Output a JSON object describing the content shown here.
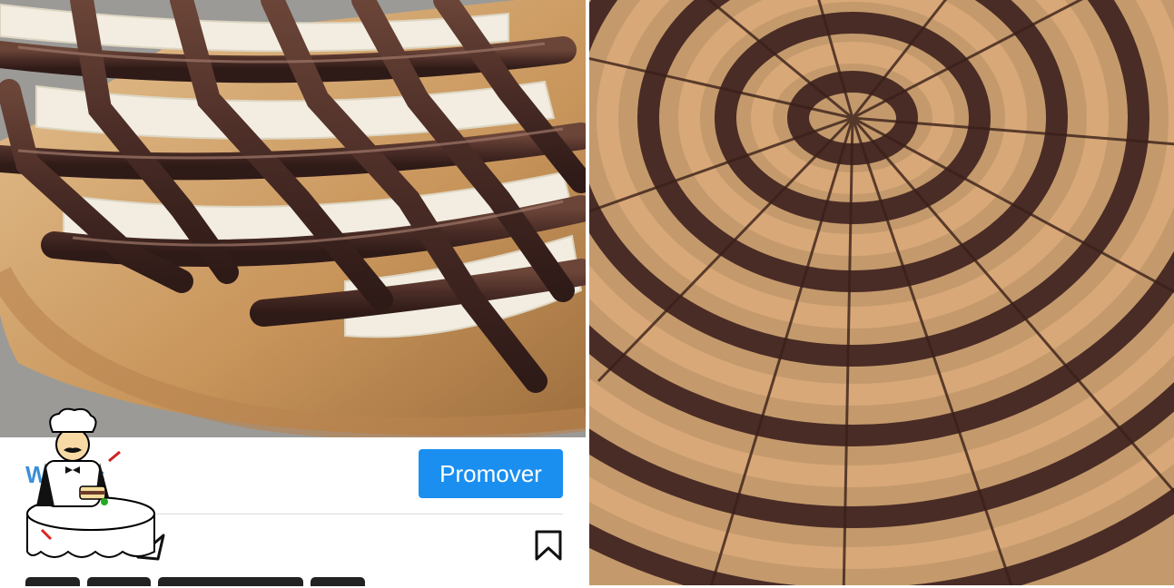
{
  "profile": {
    "name": "Wights"
  },
  "actions": {
    "promote_label": "Promover"
  },
  "icons": {
    "send": "send-icon",
    "bookmark": "bookmark-icon",
    "chef": "chef-restaurant-icon"
  },
  "colors": {
    "accent": "#1a8ff0",
    "name": "#3b8fd6",
    "chocolate": "#4a2c26",
    "cream": "#f2ede0",
    "caramel": "#d9a878"
  }
}
